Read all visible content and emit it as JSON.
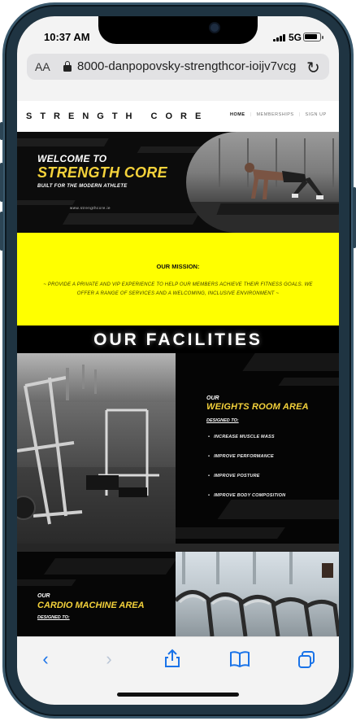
{
  "status": {
    "time": "10:37 AM",
    "network": "5G"
  },
  "browser": {
    "text_size_label": "AA",
    "url": "8000-danpopovsky-strengthcor-ioijv7vcg",
    "icons": [
      "lock-icon",
      "reload-icon",
      "back-icon",
      "forward-icon",
      "share-icon",
      "bookmarks-icon",
      "tabs-icon"
    ]
  },
  "site": {
    "brand": "STRENGTH CORE",
    "nav": {
      "home": "HOME",
      "memberships": "MEMBERSHIPS",
      "signup": "SIGN UP"
    },
    "hero": {
      "line1": "WELCOME TO",
      "line2": "STRENGTH CORE",
      "tagline": "BUILT FOR THE MODERN ATHLETE",
      "url": "www.strengthcore.ie"
    },
    "mission": {
      "title": "OUR MISSION:",
      "text": "~ PROVIDE A PRIVATE AND VIP EXPERIENCE TO HELP OUR MEMBERS ACHIEVE THEIR FITNESS GOALS. WE OFFER A RANGE OF SERVICES AND A WELCOMING, INCLUSIVE ENVIRONMENT ~"
    },
    "facilities_title": "OUR FACILITIES",
    "weights": {
      "our": "OUR",
      "title": "WEIGHTS ROOM AREA",
      "designed": "DESIGNED TO:",
      "items": [
        "INCREASE MUSCLE MASS",
        "IMPROVE PERFORMANCE",
        "IMPROVE POSTURE",
        "IMPROVE BODY COMPOSITION"
      ]
    },
    "cardio": {
      "our": "OUR",
      "title": "CARDIO MACHINE AREA",
      "designed": "DESIGNED TO:"
    }
  },
  "colors": {
    "accent_yellow": "#f4d23b",
    "mission_bg": "#ffff00",
    "safari_blue": "#1a73e8"
  }
}
